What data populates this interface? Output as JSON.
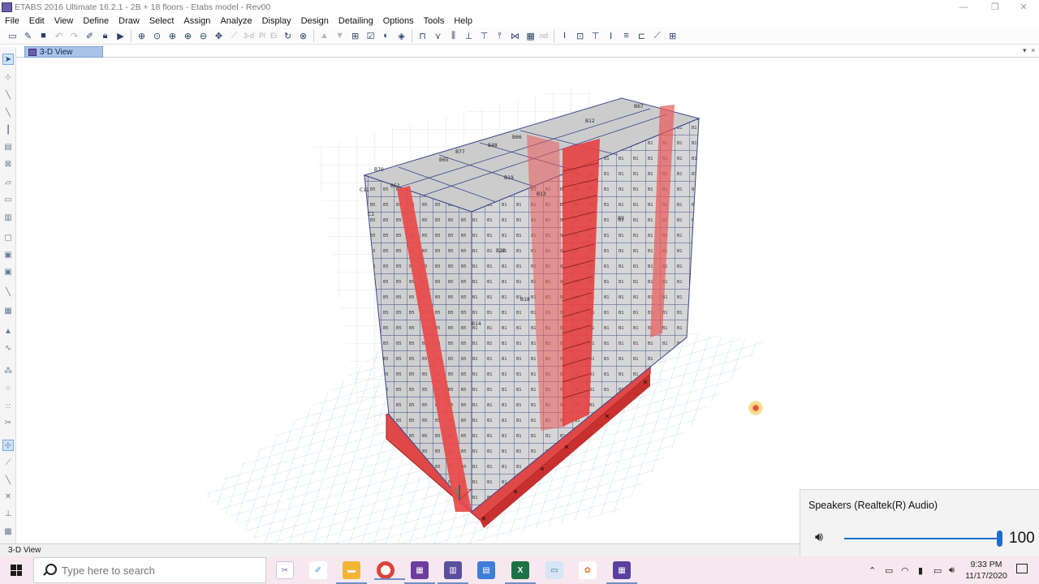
{
  "window": {
    "title": "ETABS 2016 Ultimate 16.2.1 - 2B + 18 floors - Etabs model - Rev00",
    "minimize": "—",
    "restore": "❐",
    "close": "✕"
  },
  "menu": [
    "File",
    "Edit",
    "View",
    "Define",
    "Draw",
    "Select",
    "Assign",
    "Analyze",
    "Display",
    "Design",
    "Detailing",
    "Options",
    "Tools",
    "Help"
  ],
  "toolbar": {
    "view_3d": "3-d",
    "plan": "Pl",
    "elev": "El",
    "nd": "nd"
  },
  "doc_tab": {
    "label": "3-D View",
    "dropdown": "▾",
    "close": "×"
  },
  "status": {
    "view_name": "3-D View"
  },
  "volume_flyout": {
    "device": "Speakers (Realtek(R) Audio)",
    "level": 100,
    "level_text": "100"
  },
  "taskbar": {
    "search_placeholder": "Type here to search",
    "time": "9:33 PM",
    "date": "11/17/2020",
    "apps": [
      {
        "name": "snip-app",
        "color": "#7b5fb0"
      },
      {
        "name": "paint-app",
        "color": "#4a9fd8"
      },
      {
        "name": "file-explorer",
        "color": "#f2b632"
      },
      {
        "name": "chrome",
        "color": "#db4437"
      },
      {
        "name": "etabs-app-1",
        "color": "#6b3fa0"
      },
      {
        "name": "etabs-app-2",
        "color": "#5a4e9e"
      },
      {
        "name": "calculator",
        "color": "#3d7dd8"
      },
      {
        "name": "excel",
        "color": "#1e7145"
      },
      {
        "name": "notes-app",
        "color": "#6aa6d8"
      },
      {
        "name": "paint3d-app",
        "color": "#e07a2f"
      },
      {
        "name": "etabs-running",
        "color": "#5b3f9e"
      }
    ]
  },
  "model": {
    "labels": [
      "B70",
      "B52",
      "B65",
      "B77",
      "B19",
      "B13",
      "B48",
      "B66",
      "C11",
      "C1",
      "B12",
      "B67",
      "B22",
      "B18",
      "B9",
      "B14"
    ]
  }
}
